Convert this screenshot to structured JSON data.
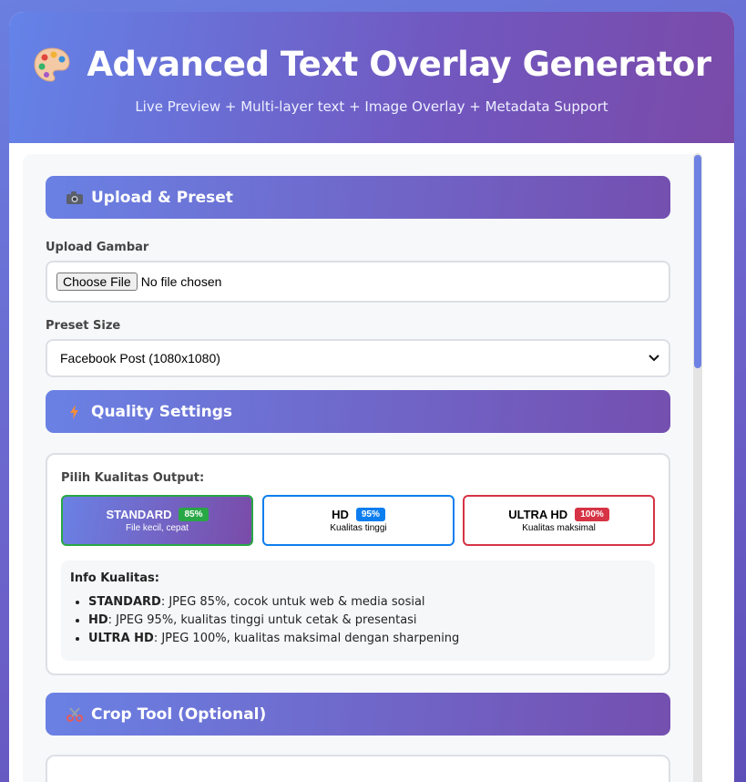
{
  "header": {
    "title": "Advanced Text Overlay Generator",
    "subtitle": "Live Preview + Multi-layer text + Image Overlay + Metadata Support"
  },
  "upload_section": {
    "heading": "Upload & Preset",
    "upload_label": "Upload Gambar",
    "file_button": "Choose File",
    "file_status": "No file chosen",
    "preset_label": "Preset Size",
    "preset_value": "Facebook Post (1080x1080)"
  },
  "quality_section": {
    "heading": "Quality Settings",
    "label": "Pilih Kualitas Output:",
    "options": [
      {
        "name": "STANDARD",
        "badge": "85%",
        "desc": "File kecil, cepat",
        "badge_color": "#28a745"
      },
      {
        "name": "HD",
        "badge": "95%",
        "desc": "Kualitas tinggi",
        "badge_color": "#0d7ef0"
      },
      {
        "name": "ULTRA HD",
        "badge": "100%",
        "desc": "Kualitas maksimal",
        "badge_color": "#d63344"
      }
    ],
    "selected": "STANDARD",
    "info_title": "Info Kualitas:",
    "info_items": [
      {
        "term": "STANDARD",
        "text": ": JPEG 85%, cocok untuk web & media sosial"
      },
      {
        "term": "HD",
        "text": ": JPEG 95%, kualitas tinggi untuk cetak & presentasi"
      },
      {
        "term": "ULTRA HD",
        "text": ": JPEG 100%, kualitas maksimal dengan sharpening"
      }
    ]
  },
  "crop_section": {
    "heading": "Crop Tool (Optional)"
  },
  "colors": {
    "accent_start": "#6a81e4",
    "accent_end": "#744fb0"
  }
}
